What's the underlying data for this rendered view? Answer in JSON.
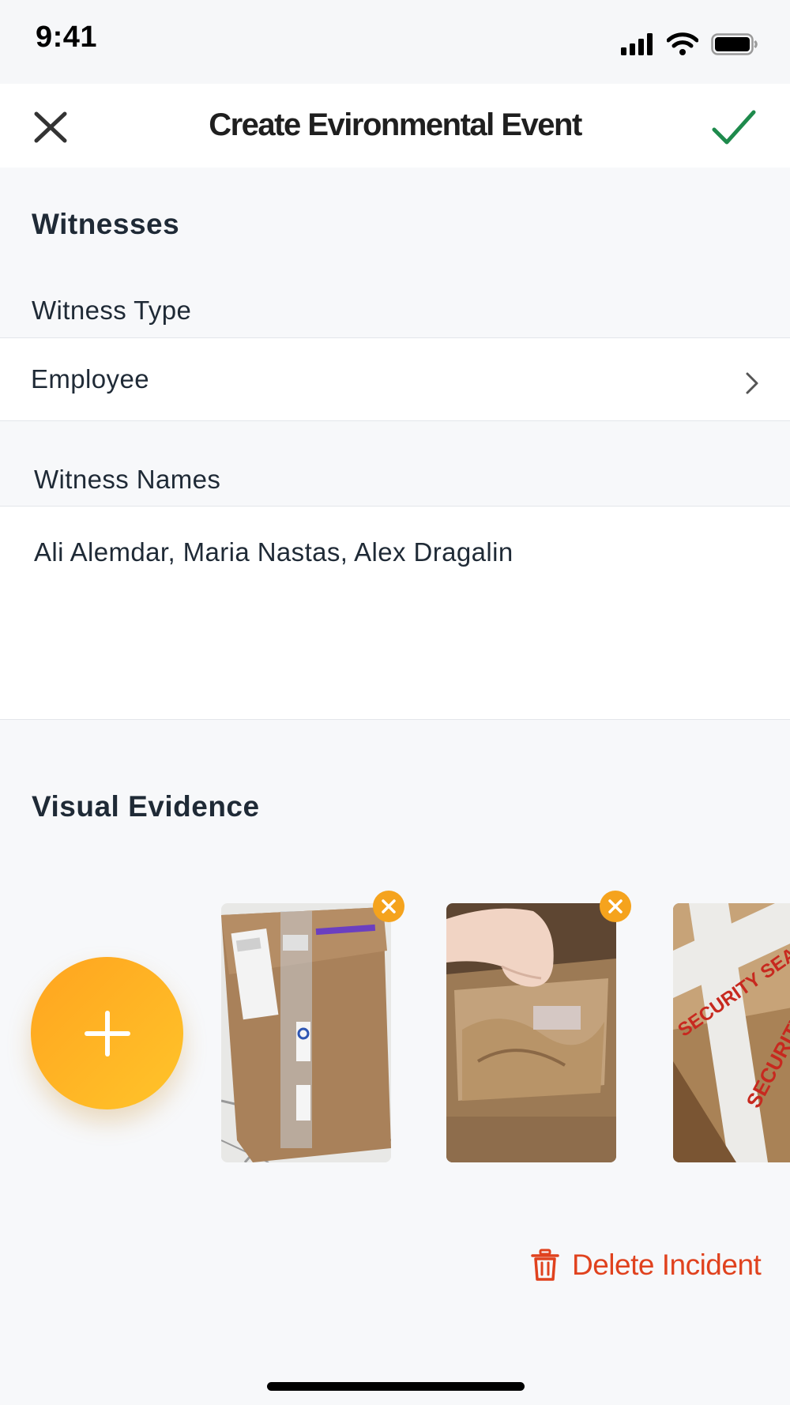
{
  "status_bar": {
    "time": "9:41",
    "icons": [
      "cellular-signal-icon",
      "wifi-icon",
      "battery-icon"
    ]
  },
  "nav": {
    "title": "Create Evironmental Event",
    "close_icon": "close-icon",
    "confirm_icon": "checkmark-icon"
  },
  "witnesses": {
    "section_title": "Witnesses",
    "type_label": "Witness Type",
    "type_value": "Employee",
    "names_label": "Witness Names",
    "names_value": "Ali Alemdar, Maria Nastas, Alex Dragalin"
  },
  "visual_evidence": {
    "section_title": "Visual Evidence",
    "add_icon": "plus-icon",
    "photos": [
      {
        "name": "photo-taped-box",
        "removable": true
      },
      {
        "name": "photo-opened-box",
        "removable": true
      },
      {
        "name": "photo-security-seal-box",
        "removable": false,
        "visible_text": "SECURITY SEAL"
      }
    ]
  },
  "actions": {
    "delete_label": "Delete Incident",
    "delete_icon": "trash-icon"
  },
  "colors": {
    "accent_green": "#1e8a4c",
    "accent_orange": "#f5a31d",
    "danger_red": "#e0421e",
    "background": "#f7f8fa"
  }
}
